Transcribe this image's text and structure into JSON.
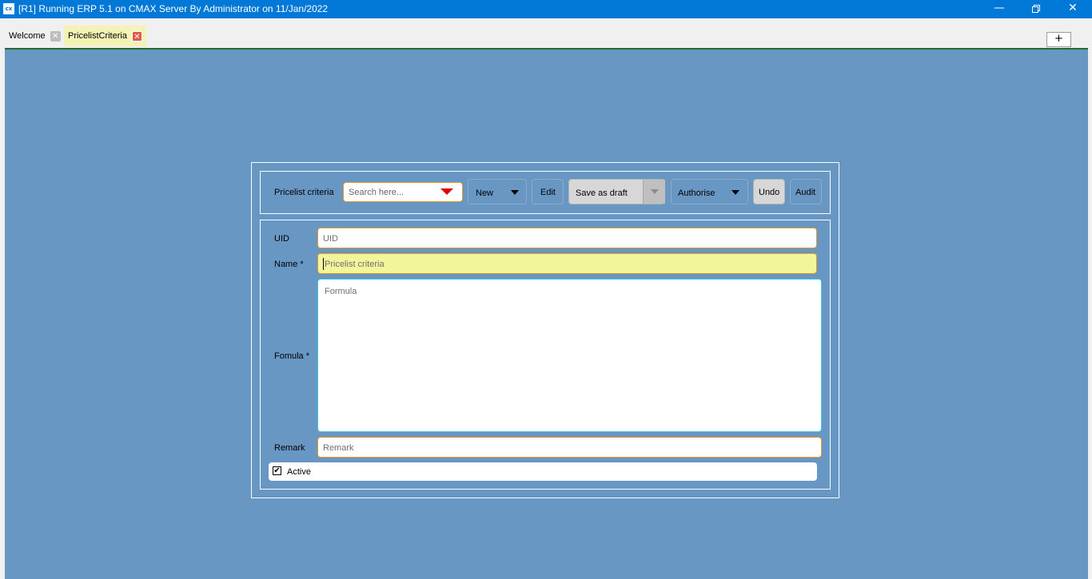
{
  "window": {
    "title": "[R1] Running ERP 5.1 on CMAX Server By Administrator on 11/Jan/2022",
    "icon_text": "cx",
    "minimize_icon": "minimize-icon",
    "maximize_icon": "restore-icon",
    "close_icon": "close-icon"
  },
  "tabs": [
    {
      "label": "Welcome",
      "active": false
    },
    {
      "label": "PricelistCriteria",
      "active": true
    }
  ],
  "add_tab_label": "+",
  "toolbar": {
    "form_label": "Pricelist criteria",
    "search_placeholder": "Search here...",
    "new_label": "New",
    "edit_label": "Edit",
    "save_label": "Save as draft",
    "authorise_label": "Authorise",
    "undo_label": "Undo",
    "audit_label": "Audit"
  },
  "form": {
    "uid": {
      "label": "UID",
      "value": "",
      "placeholder": "UID"
    },
    "name": {
      "label": "Name *",
      "value": "",
      "placeholder": "Pricelist criteria"
    },
    "formula": {
      "label": "Fomula *",
      "value": "",
      "placeholder": "Formula"
    },
    "remark": {
      "label": "Remark",
      "value": "",
      "placeholder": "Remark"
    },
    "active": {
      "label": "Active",
      "checked": true,
      "mark": "✔"
    }
  },
  "colors": {
    "titlebar": "#0078d7",
    "workarea": "#6897c3",
    "active_tab": "#f3f3b5",
    "required_field": "#f3f59b",
    "field_border": "#e39a2b",
    "search_arrow": "#e00000"
  }
}
